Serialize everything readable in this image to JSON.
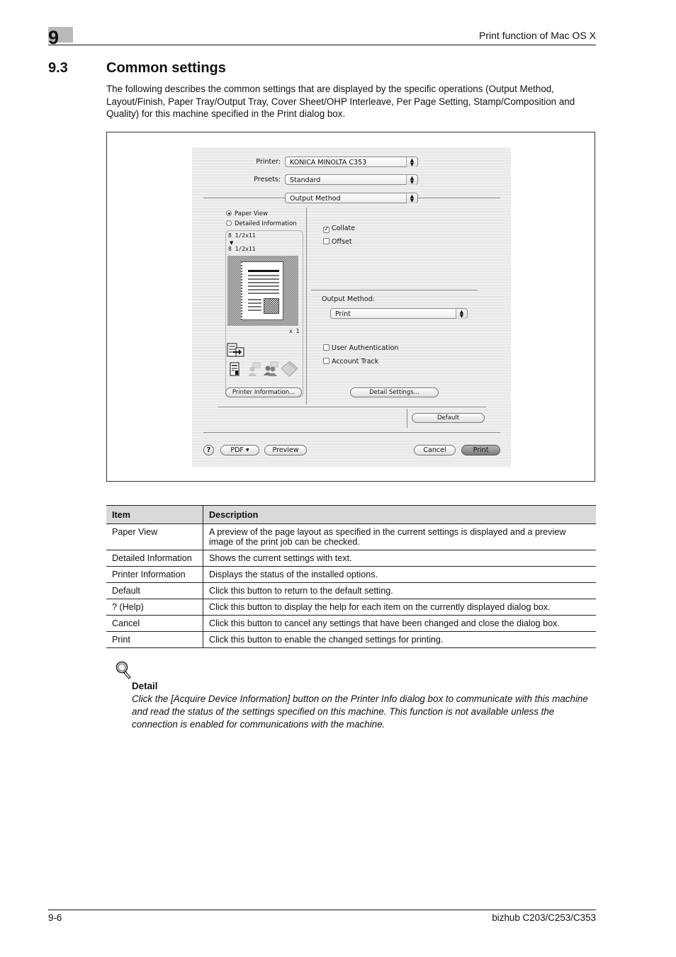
{
  "header": {
    "chapter_number": "9",
    "running_title": "Print function of Mac OS X"
  },
  "section": {
    "number": "9.3",
    "title": "Common settings",
    "intro": "The following describes the common settings that are displayed by the specific operations (Output Method, Layout/Finish, Paper Tray/Output Tray, Cover Sheet/OHP Interleave, Per Page Setting, Stamp/Composition and Quality) for this machine specified in the Print dialog box."
  },
  "dialog": {
    "printer_label": "Printer:",
    "printer_value": "KONICA MINOLTA C353",
    "presets_label": "Presets:",
    "presets_value": "Standard",
    "panel_value": "Output Method",
    "view_options": [
      {
        "label": "Paper View",
        "selected": true
      },
      {
        "label": "Detailed Information",
        "selected": false
      }
    ],
    "original_size": "8 1/2x11",
    "output_size": "8 1/2x11",
    "size_arrow": "▼",
    "copies_readout": "x 1",
    "printer_info_button": "Printer Information...",
    "collate": {
      "label": "Collate",
      "checked": true
    },
    "offset": {
      "label": "Offset",
      "checked": false
    },
    "output_method_label": "Output Method:",
    "output_method_value": "Print",
    "user_authentication": {
      "label": "User Authentication",
      "checked": false
    },
    "account_track": {
      "label": "Account Track",
      "checked": false
    },
    "detail_settings_button": "Detail Settings...",
    "default_button": "Default",
    "help_button": "?",
    "pdf_button": "PDF ▾",
    "preview_button": "Preview",
    "cancel_button": "Cancel",
    "print_button": "Print",
    "check_mark": "✓"
  },
  "table": {
    "headers": [
      "Item",
      "Description"
    ],
    "rows": [
      {
        "item": "Paper View",
        "description": "A preview of the page layout as specified in the current settings is displayed and a preview image of the print job can be checked."
      },
      {
        "item": "Detailed Information",
        "description": "Shows the current settings with text."
      },
      {
        "item": "Printer Information",
        "description": "Displays the status of the installed options."
      },
      {
        "item": "Default",
        "description": "Click this button to return to the default setting."
      },
      {
        "item": "? (Help)",
        "description": "Click this button to display the help for each item on the currently displayed dialog box."
      },
      {
        "item": "Cancel",
        "description": "Click this button to cancel any settings that have been changed and close the dialog box."
      },
      {
        "item": "Print",
        "description": "Click this button to enable the changed settings for printing."
      }
    ]
  },
  "detail_note": {
    "icon": "magnifier-icon",
    "heading": "Detail",
    "body": "Click the [Acquire Device Information] button on the Printer Info dialog box to communicate with this machine and read the status of the settings specified on this machine. This function is not available unless the connection is enabled for communications with the machine."
  },
  "footer": {
    "page_number": "9-6",
    "product": "bizhub C203/C253/C353"
  }
}
